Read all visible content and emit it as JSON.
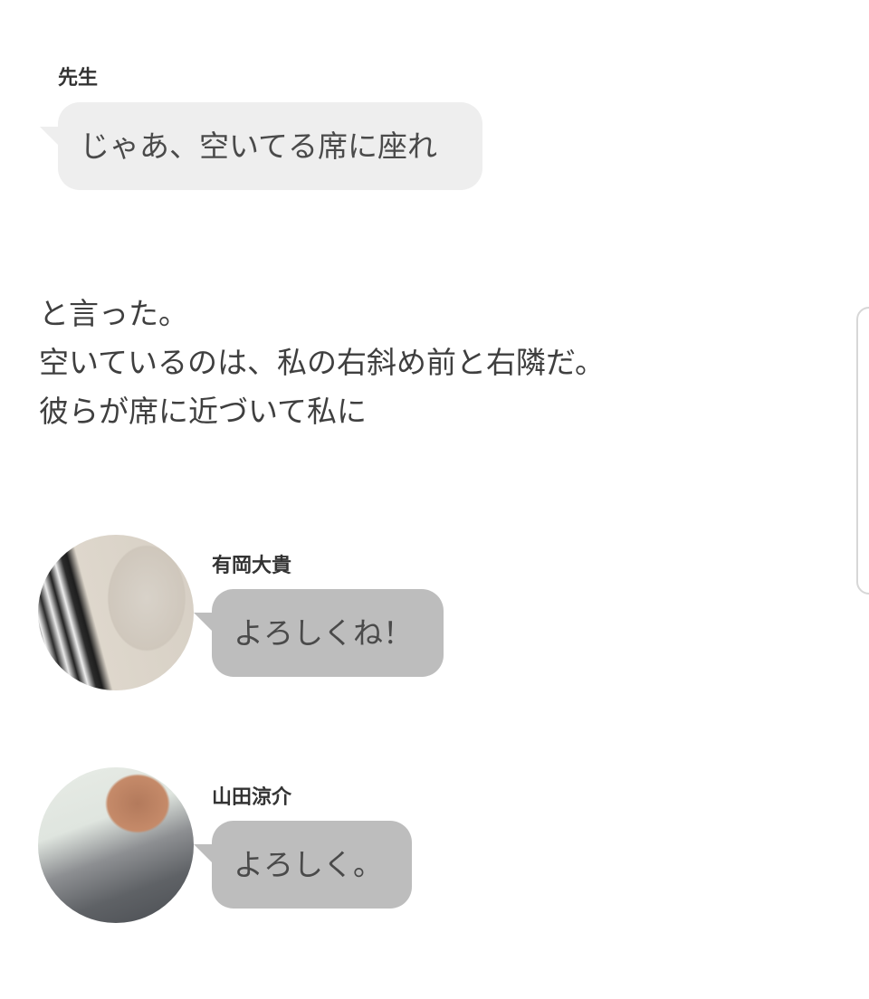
{
  "messages": [
    {
      "speaker": "先生",
      "text": "じゃあ、空いてる席に座れ"
    },
    {
      "speaker": "有岡大貴",
      "text": "よろしくね！"
    },
    {
      "speaker": "山田涼介",
      "text": "よろしく。"
    }
  ],
  "narration": {
    "lines": [
      "と言った。",
      "空いているのは、私の右斜め前と右隣だ。",
      "彼らが席に近づいて私に"
    ]
  },
  "colors": {
    "teacher_bubble": "#eeeeee",
    "character_bubble": "#bdbdbd",
    "text": "#3f3f3f"
  }
}
